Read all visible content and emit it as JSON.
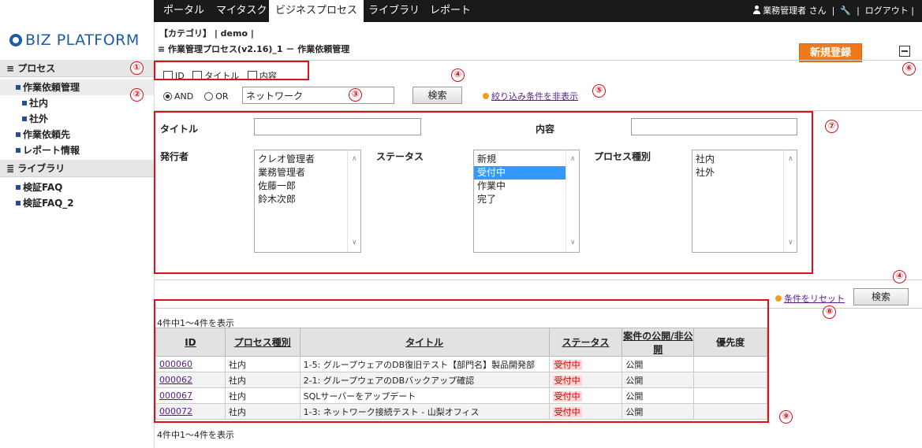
{
  "nav": {
    "items": [
      "ポータル",
      "マイタスク",
      "ビジネスプロセス",
      "ライブラリ",
      "レポート"
    ],
    "active_index": 2,
    "user": "業務管理者 さん",
    "tool_icon": "wrench-icon",
    "logout": "ログアウト"
  },
  "logo": {
    "text": "BIZ PLATFORM"
  },
  "sidebar": {
    "process_head": "プロセス",
    "process_items": [
      {
        "label": "作業依頼管理",
        "level": 1,
        "selected": true
      },
      {
        "label": "社内",
        "level": 2
      },
      {
        "label": "社外",
        "level": 2
      },
      {
        "label": "作業依頼先",
        "level": 1
      },
      {
        "label": "レポート情報",
        "level": 1
      }
    ],
    "library_head": "ライブラリ",
    "library_items": [
      {
        "label": "検証FAQ"
      },
      {
        "label": "検証FAQ_2"
      }
    ]
  },
  "header": {
    "breadcrumb": "【カテゴリ】 | demo |",
    "page_title": "作業管理プロセス(v2.16)_1 － 作業依頼管理",
    "new_button": "新規登録"
  },
  "search": {
    "check_id": "ID",
    "check_title": "タイトル",
    "check_content": "内容",
    "radio_and": "AND",
    "radio_or": "OR",
    "keyword": "ネットワーク",
    "search_button": "検索",
    "toggle_link": "絞り込み条件を非表示"
  },
  "filter": {
    "title_label": "タイトル",
    "content_label": "内容",
    "issuer_label": "発行者",
    "issuers": [
      "クレオ管理者",
      "業務管理者",
      "佐藤一郎",
      "鈴木次郎"
    ],
    "status_label": "ステータス",
    "statuses": [
      "新規",
      "受付中",
      "作業中",
      "完了"
    ],
    "status_selected": 1,
    "type_label": "プロセス種別",
    "types": [
      "社内",
      "社外"
    ],
    "reset_link": "条件をリセット",
    "search_button": "検索"
  },
  "results": {
    "count_top": "4件中1～4件を表示",
    "count_bottom": "4件中1～4件を表示",
    "headers": [
      "ID",
      "プロセス種別",
      "タイトル",
      "ステータス",
      "案件の公開/非公開",
      "優先度"
    ],
    "rows": [
      [
        "000060",
        "社内",
        "1-5: グループウェアのDB復旧テスト【部門名】製品開発部",
        "受付中",
        "公開",
        ""
      ],
      [
        "000062",
        "社内",
        "2-1: グループウェアのDBバックアップ確認",
        "受付中",
        "公開",
        ""
      ],
      [
        "000067",
        "社内",
        "SQLサーバーをアップデート",
        "受付中",
        "公開",
        ""
      ],
      [
        "000072",
        "社内",
        "1-3: ネットワーク接続テスト - 山梨オフィス",
        "受付中",
        "公開",
        ""
      ]
    ]
  },
  "annotations": [
    "①",
    "②",
    "③",
    "④",
    "⑤",
    "⑥",
    "⑦",
    "⑧",
    "⑨"
  ],
  "colors": {
    "accent": "#f07a1a",
    "annotation": "#e0101a",
    "link": "#5a1a8a",
    "nav_bg": "#1a1a1a",
    "select": "#3399ff"
  }
}
